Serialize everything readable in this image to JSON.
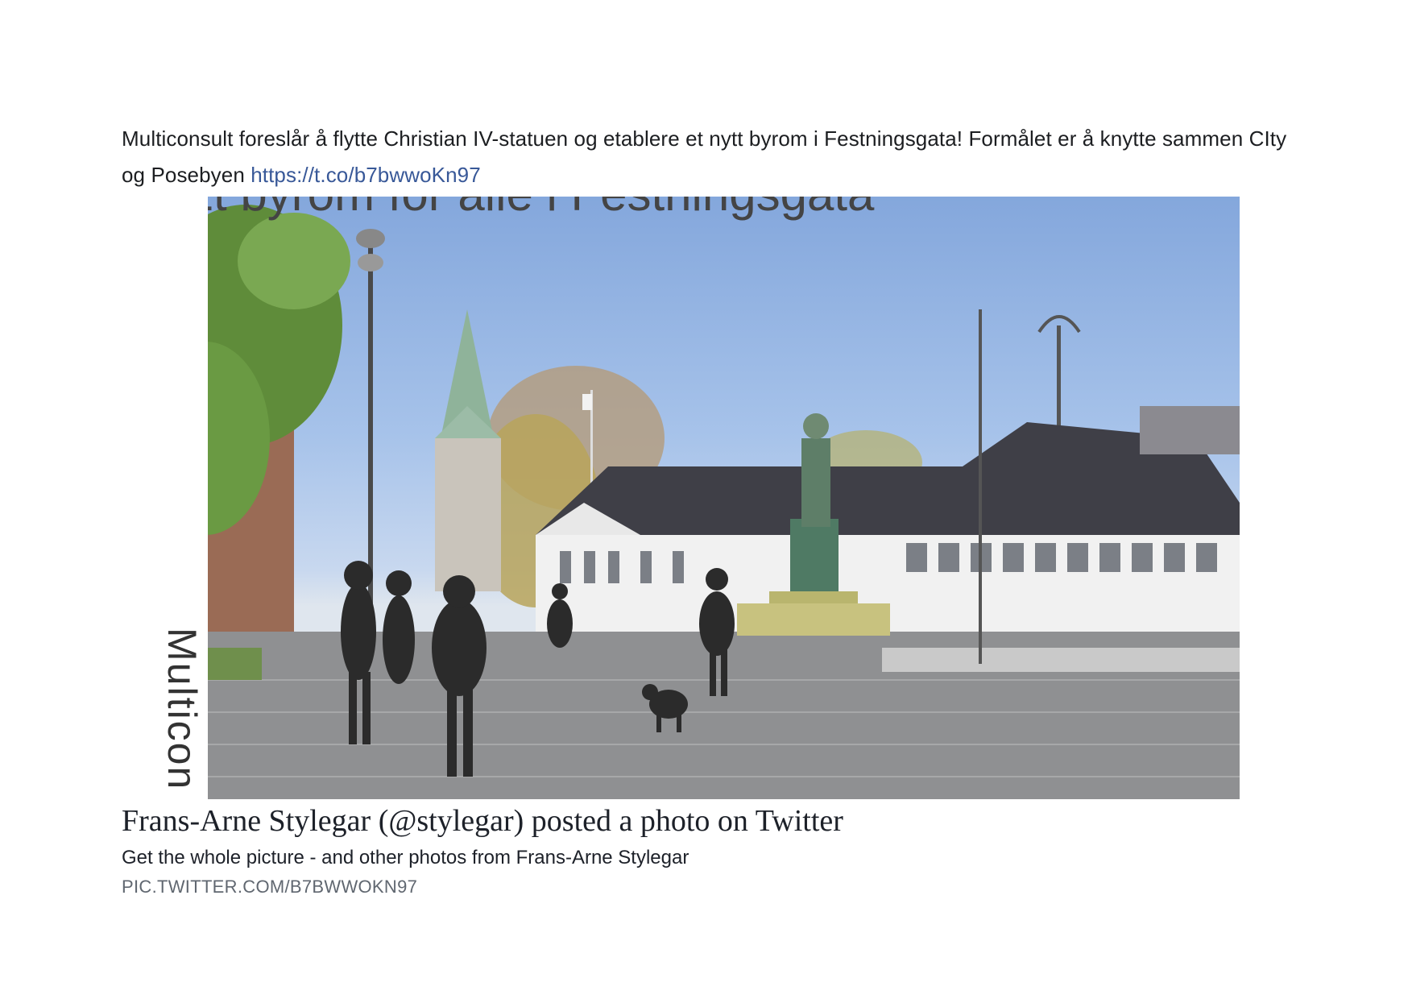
{
  "post": {
    "text": "Multiconsult foreslår å flytte Christian IV-statuen og etablere et nytt byrom i Festningsgata! Formålet er å knytte sammen CIty og Posebyen ",
    "link_text": "https://t.co/b7bwwoKn97"
  },
  "photo": {
    "sidebar_text": "Multicon",
    "title_fragment": "Et byrom for alle i Festningsgata"
  },
  "link_preview": {
    "title": "Frans-Arne Stylegar (@stylegar) posted a photo on Twitter",
    "description": "Get the whole picture - and other photos from Frans-Arne Stylegar",
    "domain": "PIC.TWITTER.COM/B7BWWOKN97"
  },
  "colors": {
    "link": "#385898",
    "text": "#1c1e21",
    "domain": "#606770"
  }
}
